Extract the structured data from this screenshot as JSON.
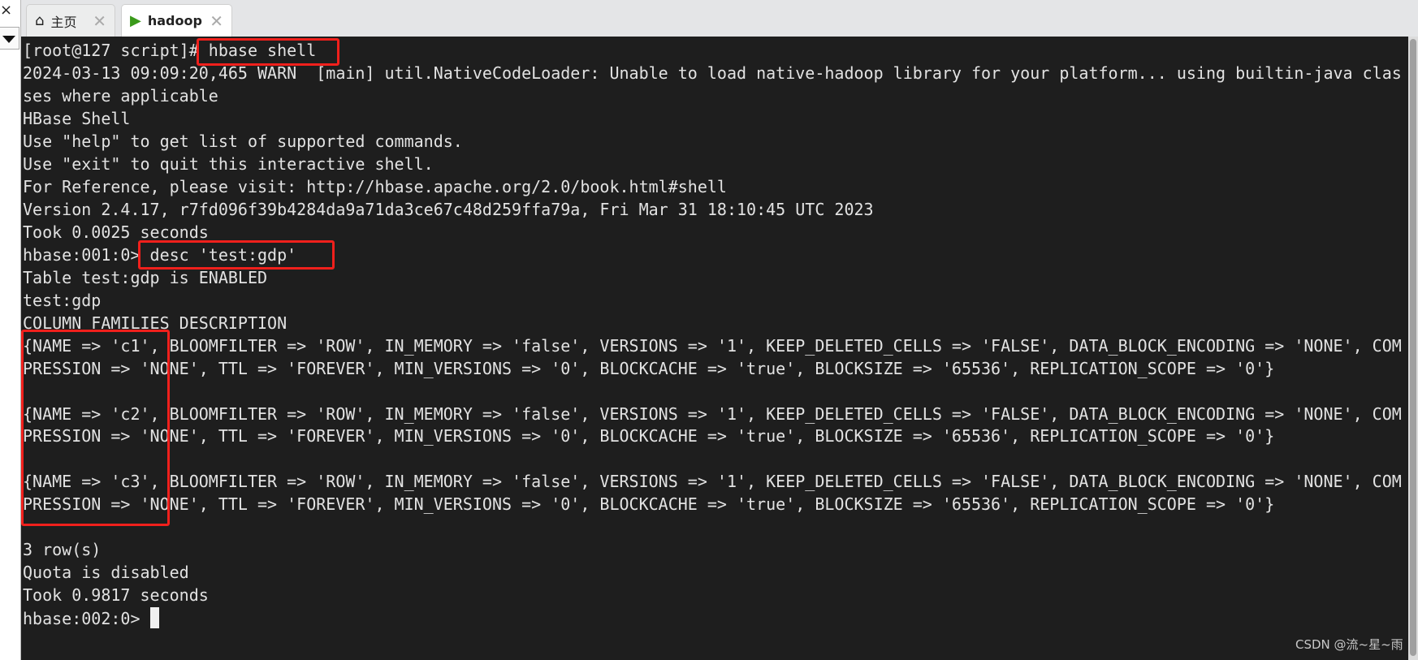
{
  "left_pane": {
    "close_glyph": "×"
  },
  "tabs": [
    {
      "label": "主页",
      "icon": "home-icon",
      "active": false
    },
    {
      "label": "hadoop",
      "icon": "terminal-play-icon",
      "active": true
    }
  ],
  "terminal": {
    "lines": [
      "[root@127 script]# hbase shell",
      "2024-03-13 09:09:20,465 WARN  [main] util.NativeCodeLoader: Unable to load native-hadoop library for your platform... using builtin-java clas",
      "ses where applicable",
      "HBase Shell",
      "Use \"help\" to get list of supported commands.",
      "Use \"exit\" to quit this interactive shell.",
      "For Reference, please visit: http://hbase.apache.org/2.0/book.html#shell",
      "Version 2.4.17, r7fd096f39b4284da9a71da3ce67c48d259ffa79a, Fri Mar 31 18:10:45 UTC 2023",
      "Took 0.0025 seconds",
      "hbase:001:0> desc 'test:gdp'",
      "Table test:gdp is ENABLED",
      "test:gdp",
      "COLUMN FAMILIES DESCRIPTION",
      "{NAME => 'c1', BLOOMFILTER => 'ROW', IN_MEMORY => 'false', VERSIONS => '1', KEEP_DELETED_CELLS => 'FALSE', DATA_BLOCK_ENCODING => 'NONE', COM",
      "PRESSION => 'NONE', TTL => 'FOREVER', MIN_VERSIONS => '0', BLOCKCACHE => 'true', BLOCKSIZE => '65536', REPLICATION_SCOPE => '0'}",
      "",
      "{NAME => 'c2', BLOOMFILTER => 'ROW', IN_MEMORY => 'false', VERSIONS => '1', KEEP_DELETED_CELLS => 'FALSE', DATA_BLOCK_ENCODING => 'NONE', COM",
      "PRESSION => 'NONE', TTL => 'FOREVER', MIN_VERSIONS => '0', BLOCKCACHE => 'true', BLOCKSIZE => '65536', REPLICATION_SCOPE => '0'}",
      "",
      "{NAME => 'c3', BLOOMFILTER => 'ROW', IN_MEMORY => 'false', VERSIONS => '1', KEEP_DELETED_CELLS => 'FALSE', DATA_BLOCK_ENCODING => 'NONE', COM",
      "PRESSION => 'NONE', TTL => 'FOREVER', MIN_VERSIONS => '0', BLOCKCACHE => 'true', BLOCKSIZE => '65536', REPLICATION_SCOPE => '0'}",
      "",
      "3 row(s)",
      "Quota is disabled",
      "Took 0.9817 seconds"
    ],
    "prompt": "hbase:002:0> "
  },
  "highlight_color": "#f0201c",
  "watermark": "CSDN @流~星~雨"
}
